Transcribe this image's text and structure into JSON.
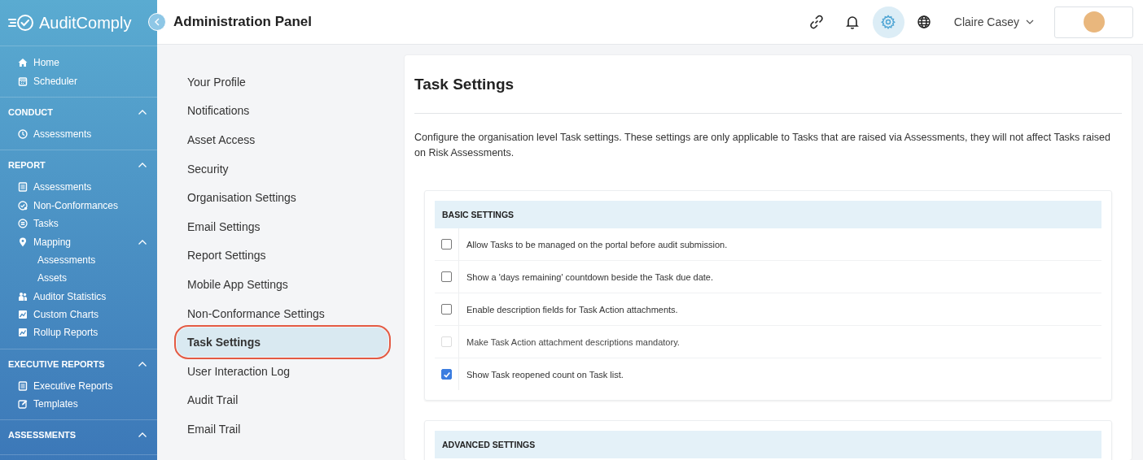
{
  "sidebar": {
    "logo": "AuditComply",
    "top_items": [
      {
        "label": "Home"
      },
      {
        "label": "Scheduler"
      }
    ],
    "sections": [
      {
        "title": "CONDUCT",
        "expanded": true,
        "items": [
          {
            "label": "Assessments"
          }
        ]
      },
      {
        "title": "REPORT",
        "expanded": true,
        "items": [
          {
            "label": "Assessments"
          },
          {
            "label": "Non-Conformances"
          },
          {
            "label": "Tasks"
          },
          {
            "label": "Mapping",
            "expanded": true,
            "children": [
              {
                "label": "Assessments"
              },
              {
                "label": "Assets"
              }
            ]
          },
          {
            "label": "Auditor Statistics"
          },
          {
            "label": "Custom Charts"
          },
          {
            "label": "Rollup Reports"
          }
        ]
      },
      {
        "title": "EXECUTIVE REPORTS",
        "expanded": true,
        "items": [
          {
            "label": "Executive Reports"
          },
          {
            "label": "Templates"
          }
        ]
      },
      {
        "title": "ASSESSMENTS",
        "expanded": true
      }
    ]
  },
  "header": {
    "title": "Administration Panel",
    "icons": [
      {
        "selected": false
      },
      {
        "selected": false
      },
      {
        "selected": true
      },
      {
        "selected": false
      }
    ],
    "user": "Claire Casey"
  },
  "settings_nav": [
    {
      "label": "Your Profile",
      "selected": false
    },
    {
      "label": "Notifications",
      "selected": false
    },
    {
      "label": "Asset Access",
      "selected": false
    },
    {
      "label": "Security",
      "selected": false
    },
    {
      "label": "Organisation Settings",
      "selected": false
    },
    {
      "label": "Email Settings",
      "selected": false
    },
    {
      "label": "Report Settings",
      "selected": false
    },
    {
      "label": "Mobile App Settings",
      "selected": false
    },
    {
      "label": "Non-Conformance Settings",
      "selected": false
    },
    {
      "label": "Task Settings",
      "selected": true
    },
    {
      "label": "User Interaction Log",
      "selected": false
    },
    {
      "label": "Audit Trail",
      "selected": false
    },
    {
      "label": "Email Trail",
      "selected": false
    }
  ],
  "content": {
    "title": "Task Settings",
    "description": "Configure the organisation level Task settings. These settings are only applicable to Tasks that are raised via Assessments, they will not affect Tasks raised on Risk Assessments.",
    "groups": [
      {
        "title": "BASIC SETTINGS",
        "options": [
          {
            "label": "Allow Tasks to be managed on the portal before audit submission.",
            "checked": false,
            "disabled": false
          },
          {
            "label": "Show a 'days remaining' countdown beside the Task due date.",
            "checked": false,
            "disabled": false
          },
          {
            "label": "Enable description fields for Task Action attachments.",
            "checked": false,
            "disabled": false
          },
          {
            "label": "Make Task Action attachment descriptions mandatory.",
            "checked": false,
            "disabled": true
          },
          {
            "label": "Show Task reopened count on Task list.",
            "checked": true,
            "disabled": false
          }
        ]
      },
      {
        "title": "ADVANCED SETTINGS"
      }
    ]
  }
}
